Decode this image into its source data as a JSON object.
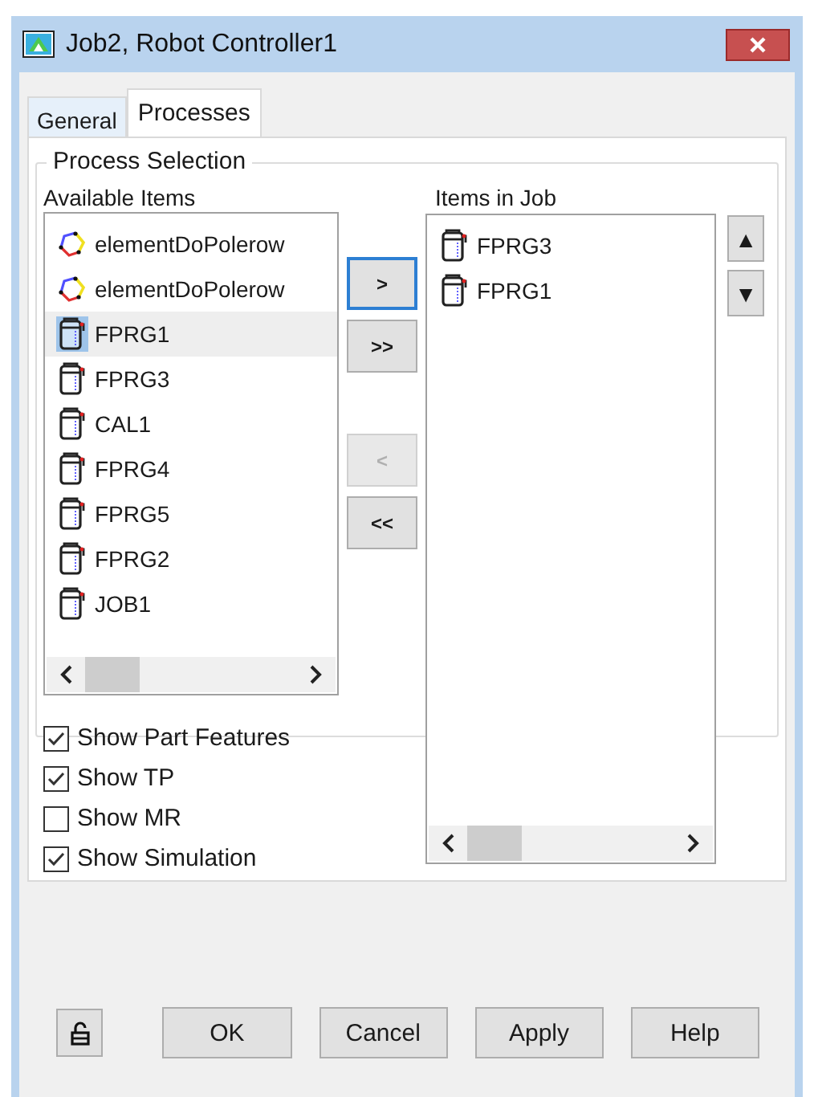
{
  "window": {
    "title": "Job2, Robot Controller1"
  },
  "tabs": [
    {
      "label": "General",
      "selected": false
    },
    {
      "label": "Processes",
      "selected": true
    }
  ],
  "group": {
    "title": "Process Selection"
  },
  "available": {
    "label": "Available Items",
    "items": [
      {
        "name": "elementDoPolerow",
        "kind": "element",
        "selected": false
      },
      {
        "name": "elementDoPolerow",
        "kind": "element",
        "selected": false
      },
      {
        "name": "FPRG1",
        "kind": "process",
        "selected": true
      },
      {
        "name": "FPRG3",
        "kind": "process",
        "selected": false
      },
      {
        "name": "CAL1",
        "kind": "process",
        "selected": false
      },
      {
        "name": "FPRG4",
        "kind": "process",
        "selected": false
      },
      {
        "name": "FPRG5",
        "kind": "process",
        "selected": false
      },
      {
        "name": "FPRG2",
        "kind": "process",
        "selected": false
      },
      {
        "name": "JOB1",
        "kind": "process",
        "selected": false
      }
    ]
  },
  "move_buttons": [
    {
      "label": ">",
      "disabled": false,
      "focused": true
    },
    {
      "label": ">>",
      "disabled": false,
      "focused": false
    },
    {
      "label": "<",
      "disabled": true,
      "focused": false
    },
    {
      "label": "<<",
      "disabled": false,
      "focused": false
    }
  ],
  "job": {
    "label": "Items in Job",
    "items": [
      {
        "name": "FPRG3",
        "kind": "process",
        "selected": false
      },
      {
        "name": "FPRG1",
        "kind": "process",
        "selected": false
      }
    ]
  },
  "order_buttons": [
    "▲",
    "▼"
  ],
  "options": [
    {
      "label": "Show Part Features",
      "checked": true
    },
    {
      "label": "Show TP",
      "checked": true
    },
    {
      "label": "Show MR",
      "checked": false
    },
    {
      "label": "Show Simulation",
      "checked": true
    }
  ],
  "buttons": [
    "OK",
    "Cancel",
    "Apply",
    "Help"
  ]
}
